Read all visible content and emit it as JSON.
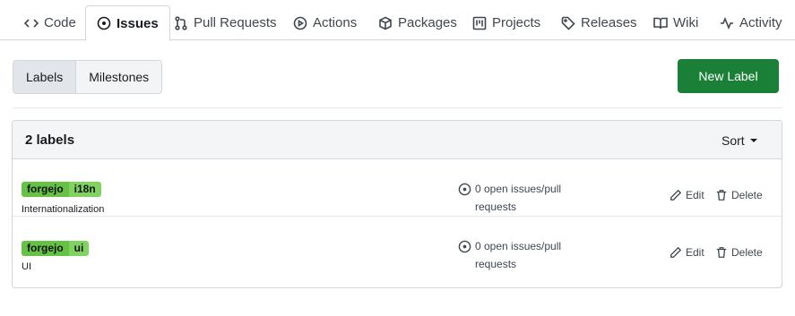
{
  "tabs": [
    {
      "label": "Code",
      "icon": "code-icon"
    },
    {
      "label": "Issues",
      "icon": "issue-opened-icon",
      "active": true
    },
    {
      "label": "Pull Requests",
      "icon": "git-pull-request-icon"
    },
    {
      "label": "Actions",
      "icon": "play-icon"
    },
    {
      "label": "Packages",
      "icon": "package-icon"
    },
    {
      "label": "Projects",
      "icon": "project-icon"
    },
    {
      "label": "Releases",
      "icon": "tag-icon"
    },
    {
      "label": "Wiki",
      "icon": "book-icon"
    },
    {
      "label": "Activity",
      "icon": "pulse-icon"
    }
  ],
  "toolbar": {
    "labels_label": "Labels",
    "milestones_label": "Milestones",
    "new_label": "New Label"
  },
  "labels_panel": {
    "count": "2 labels",
    "sort_label": "Sort",
    "rows": [
      {
        "scope": "forgejo",
        "value": "i18n",
        "description": "Internationalization",
        "open_line1": "0 open issues/pull",
        "open_line2": "requests",
        "edit": "Edit",
        "delete": "Delete"
      },
      {
        "scope": "forgejo",
        "value": "ui",
        "description": "UI",
        "open_line1": "0 open issues/pull",
        "open_line2": "requests",
        "edit": "Edit",
        "delete": "Delete"
      }
    ]
  },
  "colors": {
    "primary_button": "#1a7f37",
    "label_scope": "#65c244",
    "label_value": "#7fd35e"
  }
}
